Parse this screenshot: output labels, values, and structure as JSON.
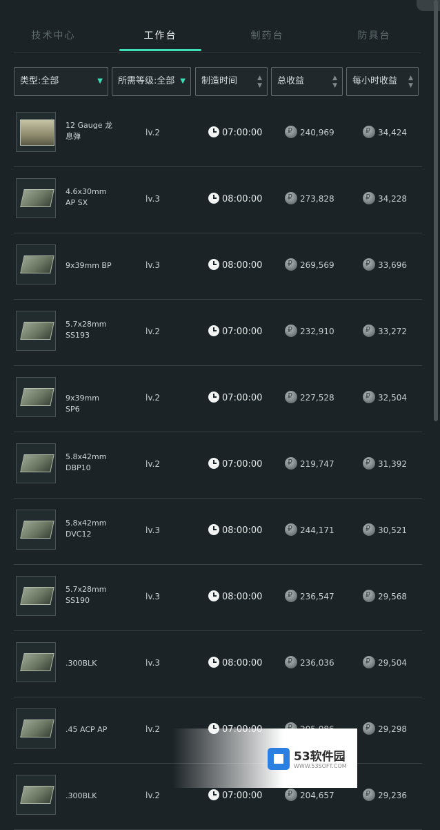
{
  "tabs": [
    {
      "label": "技术中心",
      "active": false
    },
    {
      "label": "工作台",
      "active": true
    },
    {
      "label": "制药台",
      "active": false
    },
    {
      "label": "防具台",
      "active": false
    }
  ],
  "filters": {
    "type": "类型:全部",
    "level": "所需等级:全部",
    "time": "制造时间",
    "total": "总收益",
    "hourly": "每小时收益"
  },
  "items": [
    {
      "name": "12 Gauge 龙息弹",
      "level": "lv.2",
      "time": "07:00:00",
      "total": "240,969",
      "hourly": "34,424"
    },
    {
      "name": "4.6x30mm AP SX",
      "level": "lv.3",
      "time": "08:00:00",
      "total": "273,828",
      "hourly": "34,228"
    },
    {
      "name": "9x39mm BP",
      "level": "lv.3",
      "time": "08:00:00",
      "total": "269,569",
      "hourly": "33,696"
    },
    {
      "name": "5.7x28mm SS193",
      "level": "lv.2",
      "time": "07:00:00",
      "total": "232,910",
      "hourly": "33,272"
    },
    {
      "name": "9x39mm SP6",
      "level": "lv.2",
      "time": "07:00:00",
      "total": "227,528",
      "hourly": "32,504"
    },
    {
      "name": "5.8x42mm DBP10",
      "level": "lv.2",
      "time": "07:00:00",
      "total": "219,747",
      "hourly": "31,392"
    },
    {
      "name": "5.8x42mm DVC12",
      "level": "lv.3",
      "time": "08:00:00",
      "total": "244,171",
      "hourly": "30,521"
    },
    {
      "name": "5.7x28mm SS190",
      "level": "lv.3",
      "time": "08:00:00",
      "total": "236,547",
      "hourly": "29,568"
    },
    {
      "name": ".300BLK",
      "level": "lv.3",
      "time": "08:00:00",
      "total": "236,036",
      "hourly": "29,504"
    },
    {
      "name": ".45 ACP AP",
      "level": "lv.2",
      "time": "07:00:00",
      "total": "205,086",
      "hourly": "29,298"
    },
    {
      "name": ".300BLK",
      "level": "lv.2",
      "time": "07:00:00",
      "total": "204,657",
      "hourly": "29,236"
    }
  ],
  "watermark": {
    "brand": "53软件园",
    "url": "WWW.53SOFT.COM"
  },
  "colors": {
    "accent": "#3ee0b8",
    "background": "#1c2326",
    "row_divider": "#384044"
  }
}
